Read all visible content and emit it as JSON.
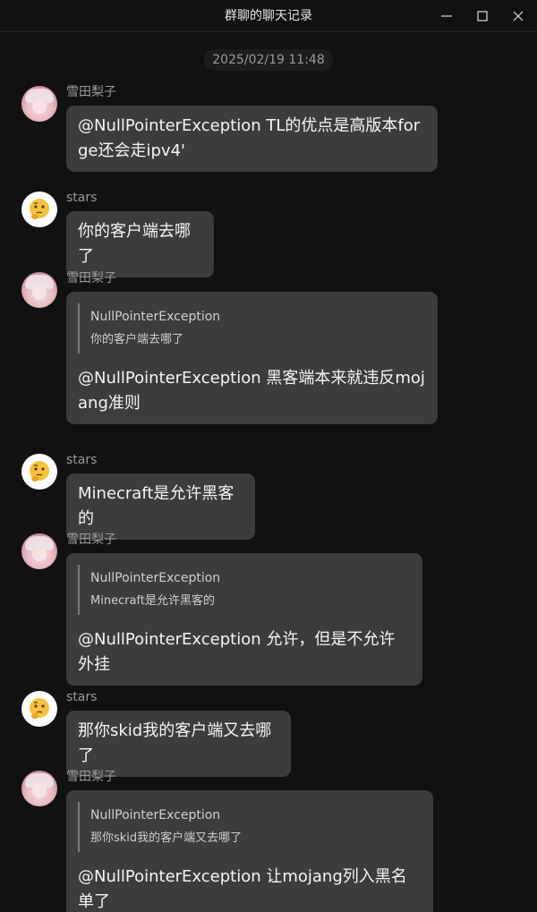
{
  "window": {
    "title": "群聊的聊天记录"
  },
  "chat": {
    "timestamp": "2025/02/19 11:48",
    "messages": [
      {
        "sender": "雪田梨子",
        "avatar": "girl-avatar",
        "text": "@NullPointerException TL的优点是高版本forge还会走ipv4'"
      },
      {
        "sender": "stars",
        "avatar": "thinking-face-emoji",
        "text": "你的客户端去哪了"
      },
      {
        "sender": "雪田梨子",
        "avatar": "girl-avatar",
        "quote": {
          "name": "NullPointerException",
          "text": "你的客户端去哪了"
        },
        "text": "@NullPointerException 黑客端本来就违反mojang准则"
      },
      {
        "sender": "stars",
        "avatar": "thinking-face-emoji",
        "text": "Minecraft是允许黑客的"
      },
      {
        "sender": "雪田梨子",
        "avatar": "girl-avatar",
        "quote": {
          "name": "NullPointerException",
          "text": "Minecraft是允许黑客的"
        },
        "text": "@NullPointerException 允许，但是不允许外挂"
      },
      {
        "sender": "stars",
        "avatar": "thinking-face-emoji",
        "text": "那你skid我的客户端又去哪了"
      },
      {
        "sender": "雪田梨子",
        "avatar": "girl-avatar",
        "quote": {
          "name": "NullPointerException",
          "text": "那你skid我的客户端又去哪了"
        },
        "text": "@NullPointerException 让mojang列入黑名单了"
      }
    ]
  },
  "colors": {
    "background": "#111111",
    "bubble": "#3c3c3c",
    "sender_name": "#9a9a9a",
    "text": "#f5f5f5"
  }
}
